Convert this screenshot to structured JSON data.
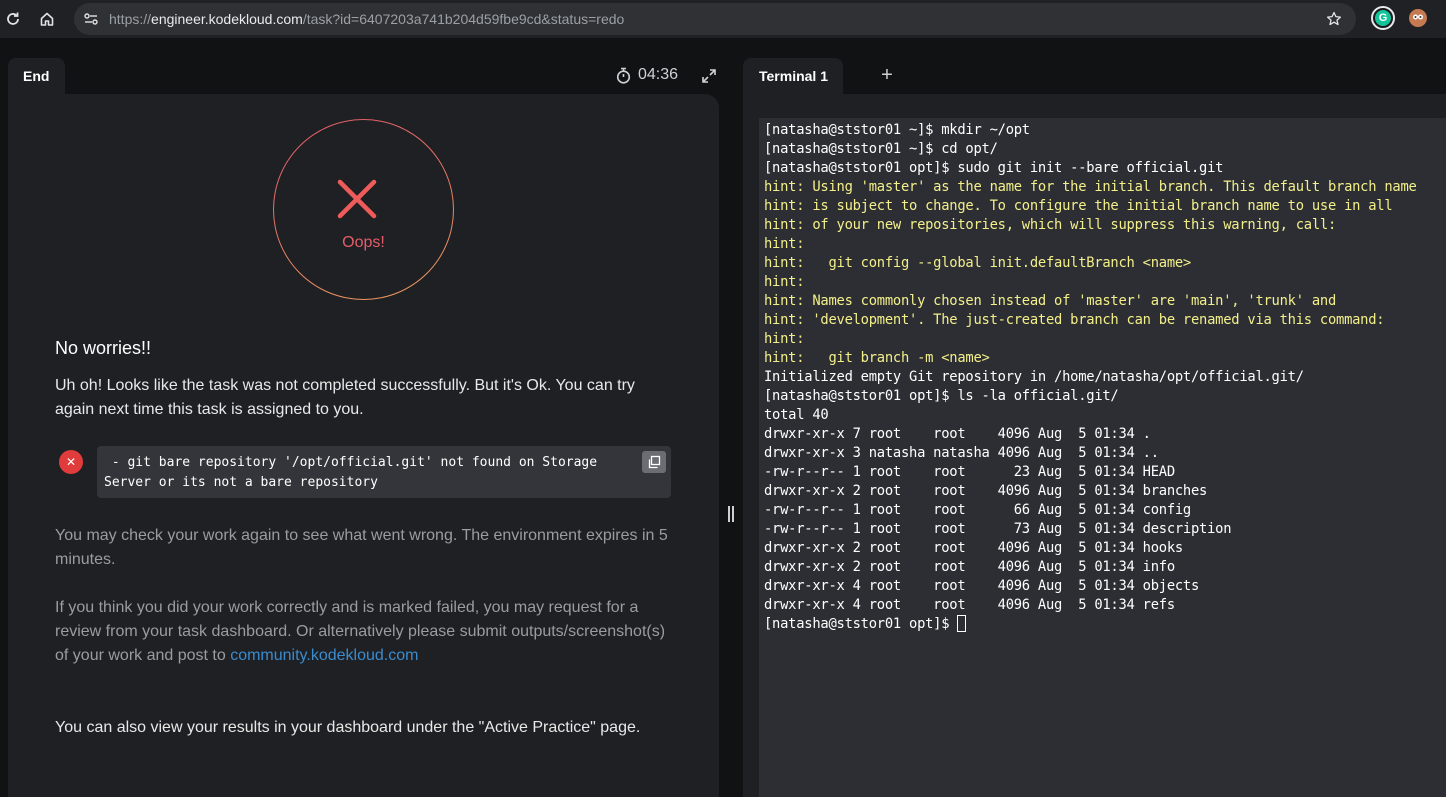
{
  "browser": {
    "url_scheme": "https://",
    "url_host": "engineer.kodekloud.com",
    "url_path": "/task?id=6407203a741b204d59fbe9cd&status=redo",
    "extension_g": "G"
  },
  "left": {
    "tab_label": "End",
    "timer": "04:36",
    "oops_text": "Oops!",
    "title": "No worries!!",
    "subtitle": "Uh oh! Looks like the task was not completed successfully. But it's Ok. You can try again next time this task is assigned to you.",
    "error_text": " - git bare repository '/opt/official.git' not found on Storage Server or its not a bare repository",
    "p1": "You may check your work again to see what went wrong. The environment expires in 5 minutes.",
    "p2_text": "If you think you did your work correctly and is marked failed, you may request for a review from your task dashboard. Or alternatively please submit outputs/screenshot(s) of your work and post to ",
    "p2_link": "community.kodekloud.com",
    "p3": "You can also view your results in your dashboard under the \"Active Practice\" page.",
    "colors": {
      "error": "#e35d6a",
      "link": "#3a8ccf",
      "panel": "#1f2023"
    }
  },
  "terminal": {
    "tab_label": "Terminal 1",
    "add_tab": "+",
    "prompt_last": "[natasha@ststor01 opt]$ ",
    "lines": [
      {
        "text": "[natasha@ststor01 ~]$ mkdir ~/opt",
        "kind": "normal"
      },
      {
        "text": "[natasha@ststor01 ~]$ cd opt/",
        "kind": "normal"
      },
      {
        "text": "[natasha@ststor01 opt]$ sudo git init --bare official.git",
        "kind": "normal"
      },
      {
        "text": "hint: Using 'master' as the name for the initial branch. This default branch name",
        "kind": "hint"
      },
      {
        "text": "hint: is subject to change. To configure the initial branch name to use in all",
        "kind": "hint"
      },
      {
        "text": "hint: of your new repositories, which will suppress this warning, call:",
        "kind": "hint"
      },
      {
        "text": "hint:",
        "kind": "hint"
      },
      {
        "text": "hint:   git config --global init.defaultBranch <name>",
        "kind": "hint"
      },
      {
        "text": "hint:",
        "kind": "hint"
      },
      {
        "text": "hint: Names commonly chosen instead of 'master' are 'main', 'trunk' and",
        "kind": "hint"
      },
      {
        "text": "hint: 'development'. The just-created branch can be renamed via this command:",
        "kind": "hint"
      },
      {
        "text": "hint:",
        "kind": "hint"
      },
      {
        "text": "hint:   git branch -m <name>",
        "kind": "hint"
      },
      {
        "text": "Initialized empty Git repository in /home/natasha/opt/official.git/",
        "kind": "normal"
      },
      {
        "text": "[natasha@ststor01 opt]$ ls -la official.git/",
        "kind": "normal"
      },
      {
        "text": "total 40",
        "kind": "normal"
      },
      {
        "text": "drwxr-xr-x 7 root    root    4096 Aug  5 01:34 .",
        "kind": "normal"
      },
      {
        "text": "drwxr-xr-x 3 natasha natasha 4096 Aug  5 01:34 ..",
        "kind": "normal"
      },
      {
        "text": "-rw-r--r-- 1 root    root      23 Aug  5 01:34 HEAD",
        "kind": "normal"
      },
      {
        "text": "drwxr-xr-x 2 root    root    4096 Aug  5 01:34 branches",
        "kind": "normal"
      },
      {
        "text": "-rw-r--r-- 1 root    root      66 Aug  5 01:34 config",
        "kind": "normal"
      },
      {
        "text": "-rw-r--r-- 1 root    root      73 Aug  5 01:34 description",
        "kind": "normal"
      },
      {
        "text": "drwxr-xr-x 2 root    root    4096 Aug  5 01:34 hooks",
        "kind": "normal"
      },
      {
        "text": "drwxr-xr-x 2 root    root    4096 Aug  5 01:34 info",
        "kind": "normal"
      },
      {
        "text": "drwxr-xr-x 4 root    root    4096 Aug  5 01:34 objects",
        "kind": "normal"
      },
      {
        "text": "drwxr-xr-x 4 root    root    4096 Aug  5 01:34 refs",
        "kind": "normal"
      }
    ],
    "colors": {
      "hint": "#f3ef8a",
      "text": "#ffffff",
      "background": "#2c2e33"
    }
  }
}
